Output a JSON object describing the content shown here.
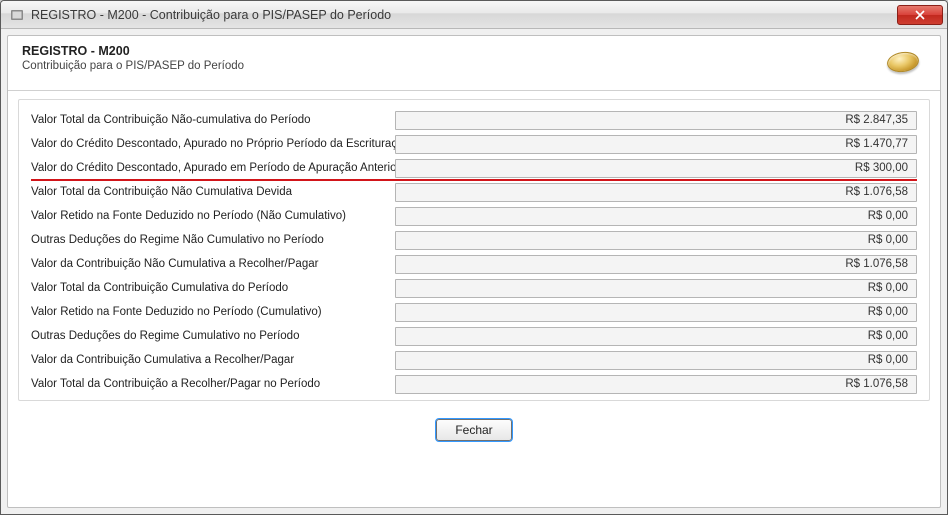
{
  "window": {
    "title": "REGISTRO - M200 - Contribuição para o PIS/PASEP do Período"
  },
  "header": {
    "title": "REGISTRO - M200",
    "subtitle": "Contribuição para o PIS/PASEP do Período"
  },
  "rows": [
    {
      "label": "Valor Total da Contribuição Não-cumulativa do Período",
      "value": "R$ 2.847,35",
      "highlight": false
    },
    {
      "label": "Valor do Crédito Descontado, Apurado no Próprio Período da Escrituração",
      "value": "R$ 1.470,77",
      "highlight": false
    },
    {
      "label": "Valor do Crédito Descontado, Apurado em Período de Apuração Anterior",
      "value": "R$ 300,00",
      "highlight": true
    },
    {
      "label": "Valor Total da Contribuição Não Cumulativa Devida",
      "value": "R$ 1.076,58",
      "highlight": false
    },
    {
      "label": "Valor Retido na Fonte Deduzido no Período (Não Cumulativo)",
      "value": "R$ 0,00",
      "highlight": false
    },
    {
      "label": "Outras Deduções do Regime Não Cumulativo no Período",
      "value": "R$ 0,00",
      "highlight": false
    },
    {
      "label": "Valor da Contribuição Não Cumulativa a Recolher/Pagar",
      "value": "R$ 1.076,58",
      "highlight": false
    },
    {
      "label": "Valor Total da Contribuição Cumulativa do Período",
      "value": "R$ 0,00",
      "highlight": false
    },
    {
      "label": "Valor Retido na Fonte Deduzido no Período (Cumulativo)",
      "value": "R$ 0,00",
      "highlight": false
    },
    {
      "label": "Outras Deduções do Regime Cumulativo no Período",
      "value": "R$ 0,00",
      "highlight": false
    },
    {
      "label": "Valor da Contribuição Cumulativa a Recolher/Pagar",
      "value": "R$ 0,00",
      "highlight": false
    },
    {
      "label": "Valor Total da Contribuição a Recolher/Pagar no Período",
      "value": "R$ 1.076,58",
      "highlight": false
    }
  ],
  "footer": {
    "close_label": "Fechar"
  }
}
